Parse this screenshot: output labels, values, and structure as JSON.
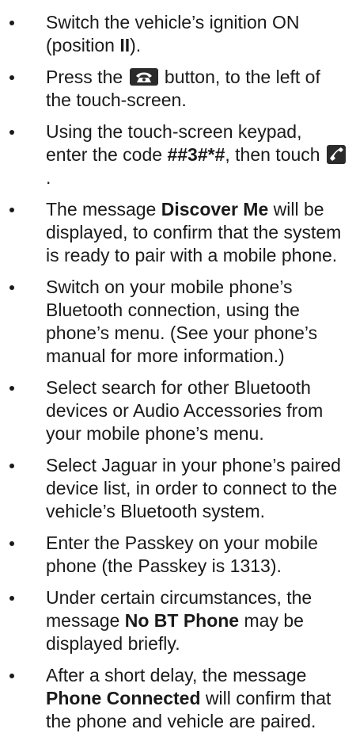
{
  "steps": [
    {
      "pre": "Switch the vehicle’s ignition ON (position ",
      "bold": "II",
      "post": ")."
    },
    {
      "pre": "Press the ",
      "icon": "phone-button-icon",
      "post": " button, to the left of the touch-screen."
    },
    {
      "pre": "Using the touch-screen keypad, enter the code ",
      "bold": "##3#*#",
      "mid": ", then touch ",
      "icon": "call-handset-icon",
      "post": "."
    },
    {
      "pre": "The message ",
      "bold": "Discover Me",
      "post": " will be displayed, to confirm that the system is ready to pair with a mobile phone."
    },
    {
      "text": "Switch on your mobile phone’s Bluetooth connection, using the phone’s menu. (See your phone’s manual for more information.)"
    },
    {
      "text": "Select search for other Bluetooth devices or Audio Accessories from your mobile phone’s menu."
    },
    {
      "text": "Select Jaguar in your phone’s paired device list, in order to connect to the vehicle’s Bluetooth system."
    },
    {
      "text": "Enter the Passkey on your mobile phone (the Passkey is 1313)."
    },
    {
      "pre": "Under certain circumstances, the message ",
      "bold": "No BT Phone",
      "post": " may be displayed briefly."
    },
    {
      "pre": "After a short delay, the message ",
      "bold": "Phone Connected",
      "post": " will confirm that the phone and vehicle are paired."
    }
  ]
}
